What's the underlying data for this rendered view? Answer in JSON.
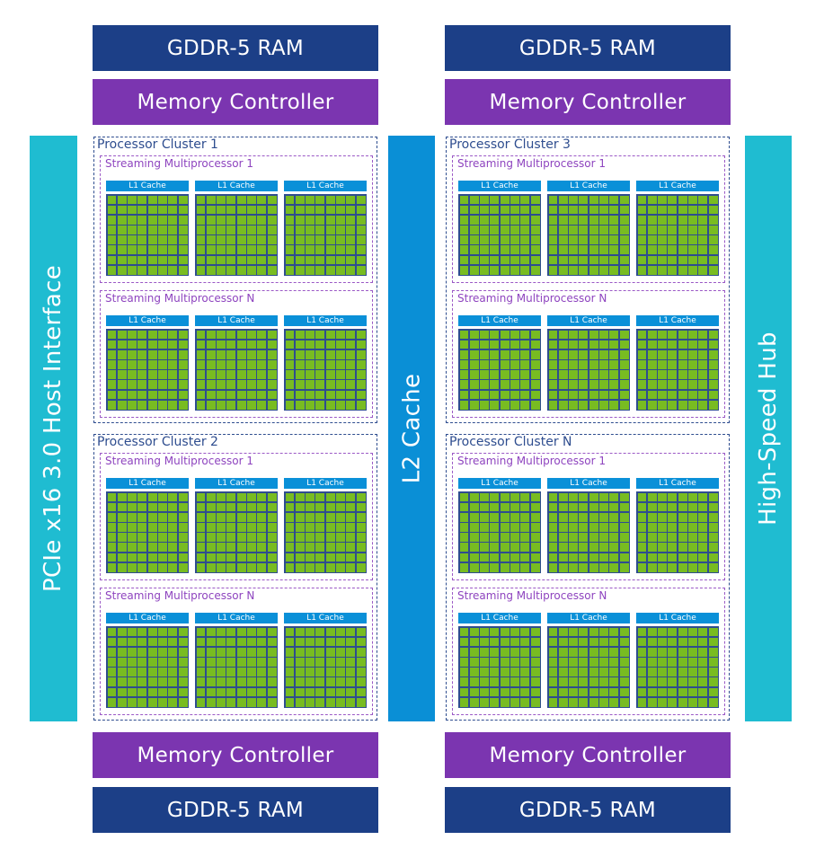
{
  "ram_label": "GDDR-5 RAM",
  "memory_controller_label": "Memory Controller",
  "host_interface_label": "PCIe x16 3.0 Host Interface",
  "l2_cache_label": "L2 Cache",
  "hub_label": "High-Speed Hub",
  "l1_cache_label": "L1 Cache",
  "clusters": [
    {
      "label": "Processor Cluster 1",
      "sms": [
        "Streaming Multiprocessor 1",
        "Streaming Multiprocessor N"
      ]
    },
    {
      "label": "Processor Cluster 2",
      "sms": [
        "Streaming Multiprocessor 1",
        "Streaming Multiprocessor N"
      ]
    },
    {
      "label": "Processor Cluster 3",
      "sms": [
        "Streaming Multiprocessor 1",
        "Streaming Multiprocessor N"
      ]
    },
    {
      "label": "Processor Cluster N",
      "sms": [
        "Streaming Multiprocessor 1",
        "Streaming Multiprocessor N"
      ]
    }
  ],
  "cores_per_sm": 3,
  "core_grid": "8x8",
  "colors": {
    "ram": "#1c3f87",
    "memory_controller": "#7b35b0",
    "interface": "#1fbcd1",
    "l2_cache": "#0a8fd6",
    "l1_cache": "#0a90d8",
    "core": "#78bc21"
  }
}
